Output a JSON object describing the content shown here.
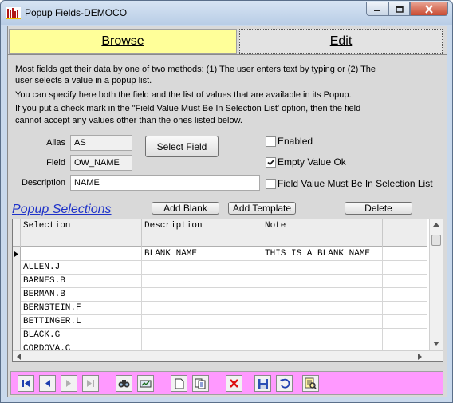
{
  "window": {
    "title": "Popup Fields-DEMOCO"
  },
  "tabs": [
    {
      "label": "Browse"
    },
    {
      "label": "Edit"
    }
  ],
  "info": [
    "Most fields get their data by one of two methods: (1) The user enters text by typing or  (2) The",
    "user selects a value in a popup list.",
    "You can specify here both the field and the list of values that are available in its Popup.",
    "If you put a check mark in the \"Field Value Must Be In Selection List' option, then the field",
    "cannot accept any values other than the ones listed below."
  ],
  "form": {
    "alias_label": "Alias",
    "alias_value": "AS",
    "field_label": "Field",
    "field_value": "OW_NAME",
    "description_label": "Description",
    "description_value": "NAME",
    "select_field_button": "Select Field"
  },
  "options": {
    "enabled_label": "Enabled",
    "enabled_checked": false,
    "empty_ok_label": "Empty Value Ok",
    "empty_ok_checked": true,
    "must_be_in_list_label": "Field Value Must Be In Selection List",
    "must_be_in_list_checked": false
  },
  "popup": {
    "section_title": "Popup Selections",
    "add_blank_button": "Add Blank",
    "add_template_button": "Add Template",
    "delete_button": "Delete",
    "columns": [
      "Selection",
      "Description",
      "Note"
    ],
    "rows": [
      {
        "selection": "",
        "description": "BLANK NAME",
        "note": "THIS IS A BLANK NAME",
        "current": true
      },
      {
        "selection": "ALLEN.J",
        "description": "",
        "note": ""
      },
      {
        "selection": "BARNES.B",
        "description": "",
        "note": ""
      },
      {
        "selection": "BERMAN.B",
        "description": "",
        "note": ""
      },
      {
        "selection": "BERNSTEIN.F",
        "description": "",
        "note": ""
      },
      {
        "selection": "BETTINGER.L",
        "description": "",
        "note": ""
      },
      {
        "selection": "BLACK.G",
        "description": "",
        "note": ""
      },
      {
        "selection": "CORDOVA.C",
        "description": "",
        "note": ""
      }
    ]
  },
  "toolbar": {
    "icons": [
      "first-record-icon",
      "prev-record-icon",
      "next-record-icon",
      "last-record-icon",
      "find-icon",
      "report-icon",
      "new-record-icon",
      "copy-record-icon",
      "delete-record-icon",
      "save-icon",
      "undo-icon",
      "view-icon"
    ]
  }
}
